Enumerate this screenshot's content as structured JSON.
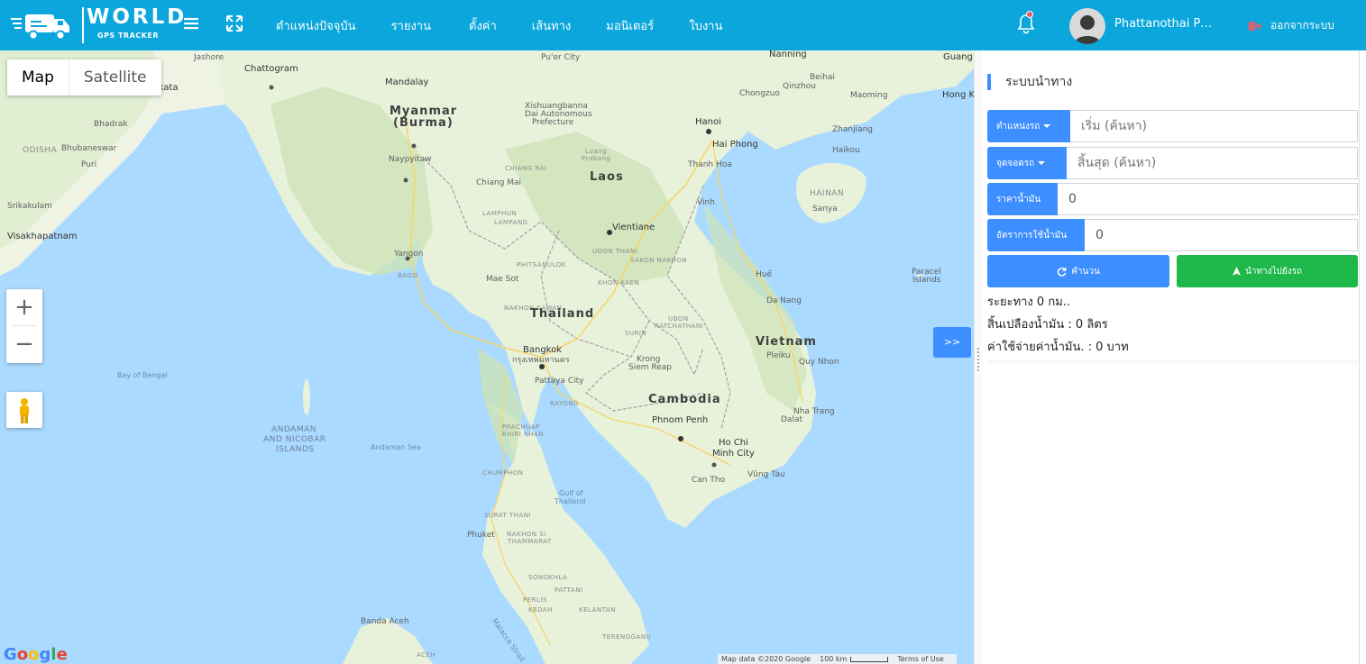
{
  "brand": {
    "word": "WORLD",
    "sub": "GPS TRACKER"
  },
  "nav": [
    {
      "label": "ตำแหน่งปัจจุบัน"
    },
    {
      "label": "รายงาน"
    },
    {
      "label": "ตั้งค่า"
    },
    {
      "label": "เส้นทาง"
    },
    {
      "label": "มอนิเตอร์"
    },
    {
      "label": "ใบงาน"
    }
  ],
  "user": {
    "name": "Phattanothai Puk..."
  },
  "logout_label": "ออกจากระบบ",
  "map": {
    "type_map": "Map",
    "type_satellite": "Satellite",
    "zoom_in": "+",
    "zoom_out": "−",
    "expand": ">>",
    "google": "Google",
    "attribution": "Map data ©2020 Google",
    "scale": "100 km",
    "terms": "Terms of Use",
    "labels": {
      "myanmar": "Myanmar",
      "burma": "(Burma)",
      "laos": "Laos",
      "thailand": "Thailand",
      "cambodia": "Cambodia",
      "vietnam": "Vietnam",
      "hainan": "HAINAN",
      "andaman": "ANDAMAN",
      "and_nicobar": "AND NICOBAR",
      "islands": "ISLANDS",
      "odisha": "ODISHA",
      "chattogram": "Chattogram",
      "kolkata": "lkata",
      "jashore": "Jashore",
      "mandalay": "Mandalay",
      "naypyitaw": "Naypyitaw",
      "yangon": "Yangon",
      "chiang_mai": "Chiang Mai",
      "vientiane": "Vientiane",
      "hanoi": "Hanoi",
      "hai_phong": "Hai Phong",
      "nanning": "Nanning",
      "guang": "Guang",
      "hong_k": "Hong K",
      "bangkok": "Bangkok",
      "bangkok_th": "กรุงเทพมหานคร",
      "pattaya": "Pattaya City",
      "phnom_penh": "Phnom Penh",
      "hcm_1": "Ho Chi",
      "hcm_2": "Minh City",
      "hue": "Huế",
      "da_nang": "Da Nang",
      "quy_nhon": "Quy Nhon",
      "nha_trang": "Nha Trang",
      "dalat": "Dalat",
      "vung_tau": "Vũng Tàu",
      "can_tho": "Can Tho",
      "siem_reap_1": "Krong",
      "siem_reap_2": "Siem Reap",
      "bay_of_bengal": "Bay of Bengal",
      "andaman_sea": "Andaman Sea",
      "gulf_1": "Gulf of",
      "gulf_2": "Thailand",
      "visakhapatnam": "Visakhapatnam",
      "srikakulam": "Srikakulam",
      "bhubaneswar": "Bhubaneswar",
      "puri": "Puri",
      "bhadrak": "Bhadrak",
      "banda_aceh": "Banda Aceh",
      "phuket": "Phuket",
      "chumphon": "CHUMPHON",
      "surat_thani": "SURAT THANI",
      "songkhla": "SONGKHLA",
      "pattani": "PATTANI",
      "kedah": "KEDAH",
      "kelantan": "KELANTAN",
      "terengganu": "TERENGGANU",
      "perlis": "PERLIS",
      "aceh": "ACEH",
      "malacca": "Malacca Strait",
      "nakhon_si": "NAKHON SI",
      "thammarat": "THAMMARAT",
      "prachuap": "PRACHUAP",
      "khiri_khan": "KHIRI KHAN",
      "rayong": "RAYONG",
      "nakhon_sawan": "NAKHON SAWAN",
      "phitsanulok": "PHITSANULOK",
      "khon_kaen": "KHON KAEN",
      "udon_thani": "UDON THANI",
      "sakon_nakhon": "SAKON NAKHON",
      "ubon": "UBON",
      "ratchathani": "RATCHATHANI",
      "surin": "SURIN",
      "lampang": "LAMPANG",
      "lamphun": "LAMPHUN",
      "chiang_rai": "CHIANG RAI",
      "mae_sot": "Mae Sot",
      "pleiku": "Pleiku",
      "vinh": "Vinh",
      "thanh_hoa": "Thanh Hoa",
      "sanya": "Sanya",
      "haikou": "Haikou",
      "zhanjiang": "Zhanjiang",
      "maoming": "Maoming",
      "beihai": "Beihai",
      "qinzhou": "Qinzhou",
      "chongzuo": "Chongzuo",
      "puer": "Pu'er City",
      "xishuangbanna_1": "Xishuangbanna",
      "xishuangbanna_2": "Dai Autonomous",
      "xishuangbanna_3": "Prefecture",
      "luang_prabang_1": "Luang",
      "luang_prabang_2": "Prabang",
      "paracel_1": "Paracel",
      "paracel_2": "Islands",
      "bago": "BAGO"
    }
  },
  "panel": {
    "title": "ระบบนำทาง",
    "start_addon": "ตำแหน่งรถ",
    "start_placeholder": "เริ่ม (ค้นหา)",
    "end_addon": "จุดจอดรถ",
    "end_placeholder": "สิ้นสุด (ค้นหา)",
    "fuel_price_addon": "ราคาน้ำมัน",
    "fuel_price_value": "0",
    "fuel_rate_addon": "อัตราการใช้น้ำมัน",
    "fuel_rate_value": "0",
    "calc_button": "คำนวน",
    "navigate_button": "นำทางไปยังรถ",
    "distance_text": "ระยะทาง 0 กม..",
    "fuel_used_text": "สิ้นเปลืองน้ำมัน : 0 ลิตร",
    "cost_text": "ค่าใช้จ่ายค่าน้ำมัน. : 0 บาท"
  },
  "colors": {
    "topbar": "#0aa6dc",
    "primary": "#3d8eff",
    "success": "#1fb84a",
    "water": "#aadaff",
    "land": "#e8f1da"
  },
  "icons": {
    "menu": "hamburger-icon",
    "fullscreen": "expand-arrows-icon",
    "bell": "bell-icon",
    "logout": "sign-out-icon"
  }
}
